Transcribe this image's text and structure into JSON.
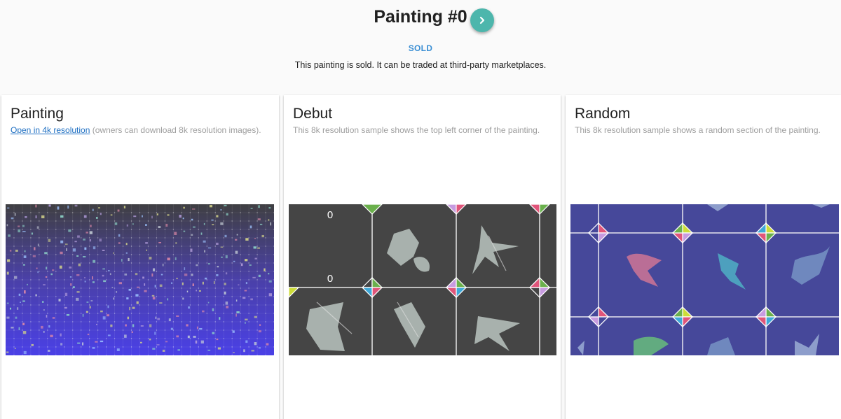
{
  "header": {
    "title": "Painting #0",
    "next_icon": "chevron-right-icon",
    "status_badge": "SOLD",
    "status_text": "This painting is sold. It can be traded at third-party marketplaces."
  },
  "cards": [
    {
      "title": "Painting",
      "link_text": "Open in 4k resolution",
      "subtitle_rest": " (owners can download 8k resolution images)."
    },
    {
      "title": "Debut",
      "subtitle": "This 8k resolution sample shows the top left corner of the painting.",
      "labels": [
        "0",
        "0"
      ]
    },
    {
      "title": "Random",
      "subtitle": "This 8k resolution sample shows a random section of the painting."
    }
  ],
  "colors": {
    "accent": "#4db6ac",
    "sold": "#3b8fd4",
    "link": "#1e6fc2",
    "debut_bg": "#454545",
    "random_bg": "#46489a"
  }
}
